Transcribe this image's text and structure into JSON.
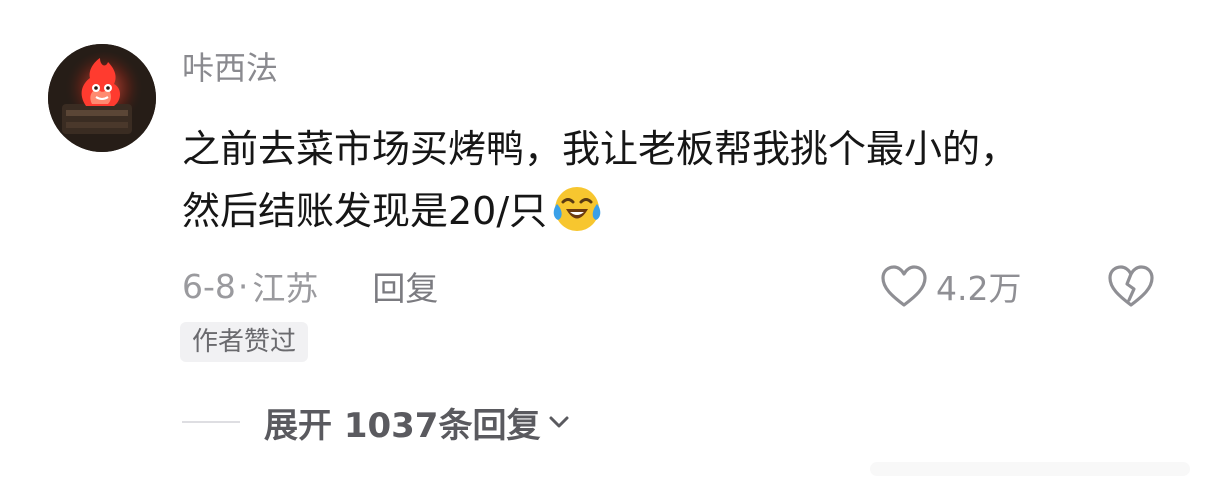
{
  "comment": {
    "username": "咔西法",
    "text_line1": "之前去菜市场买烤鸭，我让老板帮我挑个最小的，",
    "text_line2": "然后结账发现是20/只",
    "emoji": "crying-laughing-emoji",
    "date": "6-8",
    "separator": "·",
    "location": "江苏",
    "reply_label": "回复",
    "like_count": "4.2万",
    "author_badge": "作者赞过",
    "expand_replies_label": "展开 1037条回复"
  },
  "icons": {
    "avatar": "fire-demon-avatar",
    "like": "heart-outline-icon",
    "dislike": "broken-heart-icon",
    "expand": "chevron-down-icon"
  },
  "colors": {
    "text_primary": "#161616",
    "text_secondary": "#9a9a9e",
    "badge_bg": "#f1f1f3",
    "emoji_yellow": "#f7c62f",
    "tear_blue": "#3aa0e8"
  }
}
